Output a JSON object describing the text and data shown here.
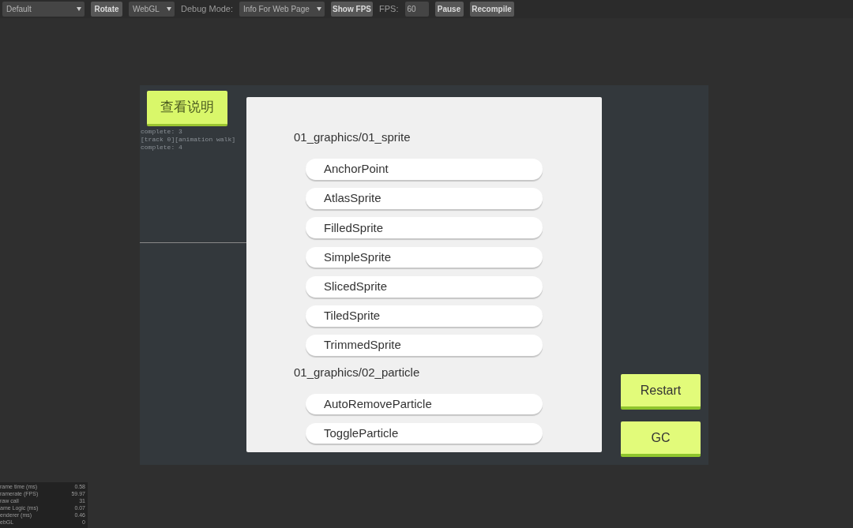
{
  "toolbar": {
    "items": [
      {
        "kind": "select",
        "value": "Default"
      },
      {
        "kind": "button",
        "label": "Rotate"
      },
      {
        "kind": "select",
        "value": "WebGL"
      },
      {
        "kind": "label",
        "label": "Debug Mode:"
      },
      {
        "kind": "select",
        "value": "Info For Web Page"
      },
      {
        "kind": "button",
        "label": "Show FPS"
      },
      {
        "kind": "label",
        "label": "FPS:"
      },
      {
        "kind": "input",
        "value": "60"
      },
      {
        "kind": "button",
        "label": "Pause"
      },
      {
        "kind": "button",
        "label": "Recompile"
      }
    ]
  },
  "game": {
    "info_button": "查看说明",
    "log": [
      "complete: 3",
      "[track 0][animation walk]",
      "complete: 4"
    ],
    "test_list": [
      {
        "kind": "heading",
        "label": "01_graphics/01_sprite"
      },
      {
        "kind": "item",
        "label": "AnchorPoint"
      },
      {
        "kind": "item",
        "label": "AtlasSprite"
      },
      {
        "kind": "item",
        "label": "FilledSprite"
      },
      {
        "kind": "item",
        "label": "SimpleSprite"
      },
      {
        "kind": "item",
        "label": "SlicedSprite"
      },
      {
        "kind": "item",
        "label": "TiledSprite"
      },
      {
        "kind": "item",
        "label": "TrimmedSprite"
      },
      {
        "kind": "heading",
        "label": "01_graphics/02_particle"
      },
      {
        "kind": "item",
        "label": "AutoRemoveParticle"
      },
      {
        "kind": "item",
        "label": "ToggleParticle"
      }
    ],
    "actions": [
      "Restart",
      "GC"
    ]
  },
  "stats": [
    {
      "label": "rame time (ms)",
      "value": "0.58"
    },
    {
      "label": "ramerate (FPS)",
      "value": "59.97"
    },
    {
      "label": "raw call",
      "value": "31"
    },
    {
      "label": "ame Logic (ms)",
      "value": "0.07"
    },
    {
      "label": "enderer (ms)",
      "value": "0.46"
    },
    {
      "label": "ebGL",
      "value": "0"
    }
  ]
}
